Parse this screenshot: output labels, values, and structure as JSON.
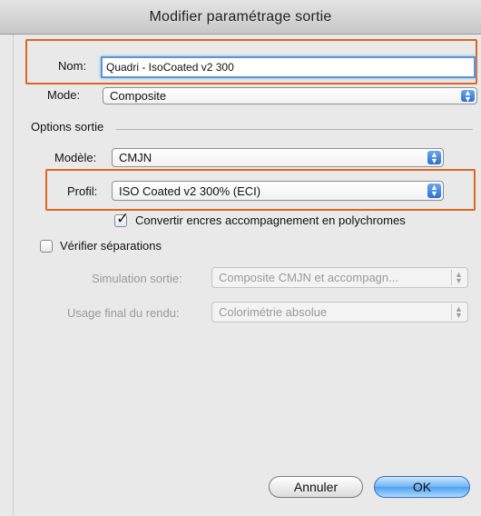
{
  "window": {
    "title": "Modifier paramétrage sortie"
  },
  "name": {
    "label": "Nom:",
    "value": "Quadri - IsoCoated v2 300"
  },
  "mode": {
    "label": "Mode:",
    "value": "Composite"
  },
  "options": {
    "section_label": "Options sortie",
    "model": {
      "label": "Modèle:",
      "value": "CMJN"
    },
    "profile": {
      "label": "Profil:",
      "value": "ISO Coated v2 300% (ECI)"
    },
    "convert_spot": {
      "label": "Convertir encres accompagnement en polychromes",
      "checked": true
    }
  },
  "verify": {
    "label": "Vérifier séparations",
    "checked": false
  },
  "simulation": {
    "label": "Simulation sortie:",
    "value": "Composite CMJN et accompagn..."
  },
  "rendering": {
    "label": "Usage final du rendu:",
    "value": "Colorimétrie absolue"
  },
  "buttons": {
    "cancel": "Annuler",
    "ok": "OK"
  },
  "colors": {
    "highlight": "#e0661f",
    "focus": "#5a95d8",
    "accent": "#2c6fd0"
  }
}
